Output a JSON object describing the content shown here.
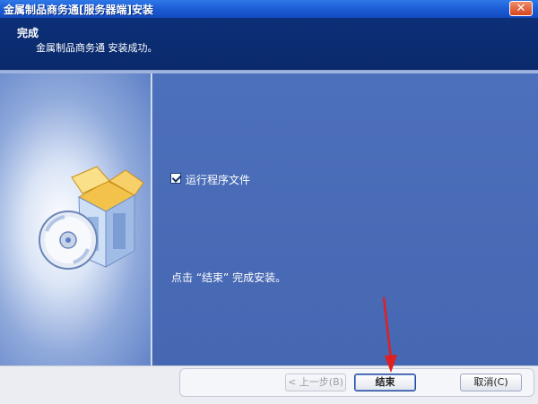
{
  "window": {
    "title": "金属制品商务通[服务器端]安装",
    "close_icon": "close-icon"
  },
  "header": {
    "title": "完成",
    "subtitle": "金属制品商务通 安装成功。"
  },
  "main": {
    "run_checkbox_label": "运行程序文件",
    "run_checked": true,
    "finish_hint": "点击 “结束” 完成安装。"
  },
  "buttons": {
    "back": "< 上一步(B)",
    "finish": "结束",
    "cancel": "取消(C)"
  },
  "colors": {
    "header_bg": "#0a2a6b",
    "main_bg": "#4a6db9",
    "annotation_arrow": "#e02020"
  },
  "icons": {
    "installer_graphic": "box-and-disc-icon",
    "arrow_annotation": "red-arrow"
  }
}
